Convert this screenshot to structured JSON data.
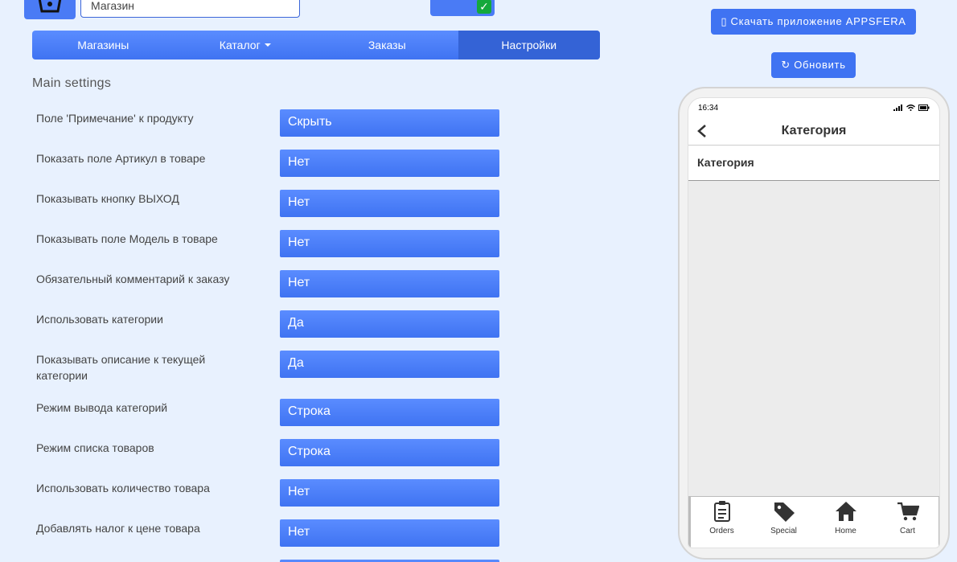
{
  "top": {
    "store_value": "Магазин"
  },
  "nav": {
    "items": [
      {
        "label": "Магазины"
      },
      {
        "label": "Каталог"
      },
      {
        "label": "Заказы"
      },
      {
        "label": "Настройки"
      }
    ]
  },
  "main": {
    "section_title": "Main settings",
    "settings": [
      {
        "label": "Поле 'Примечание' к продукту",
        "value": "Скрыть"
      },
      {
        "label": "Показать поле Артикул в товаре",
        "value": "Нет"
      },
      {
        "label": "Показывать кнопку ВЫХОД",
        "value": "Нет"
      },
      {
        "label": "Показывать поле Модель в товаре",
        "value": "Нет"
      },
      {
        "label": "Обязательный комментарий к заказу",
        "value": "Нет"
      },
      {
        "label": "Использовать категории",
        "value": "Да"
      },
      {
        "label": "Показывать описание к текущей категории",
        "value": "Да"
      },
      {
        "label": "Режим вывода категорий",
        "value": "Строка"
      },
      {
        "label": "Режим списка товаров",
        "value": "Строка"
      },
      {
        "label": "Использовать количество товара",
        "value": "Нет"
      },
      {
        "label": "Добавлять налог к цене товара",
        "value": "Нет"
      }
    ]
  },
  "right": {
    "download_label": "▯ Скачать приложение APPSFERA",
    "refresh_label": "↻ Обновить"
  },
  "phone": {
    "time": "16:34",
    "header_title": "Категория",
    "category_label": "Категория",
    "tabs": [
      {
        "label": "Orders",
        "icon": "clipboard-icon"
      },
      {
        "label": "Special",
        "icon": "tag-icon"
      },
      {
        "label": "Home",
        "icon": "home-icon"
      },
      {
        "label": "Cart",
        "icon": "cart-icon"
      }
    ]
  },
  "colors": {
    "accent": "#3f73f2",
    "active_tab": "#3463d6",
    "background": "#e8f1fe",
    "check": "#14a83c"
  }
}
